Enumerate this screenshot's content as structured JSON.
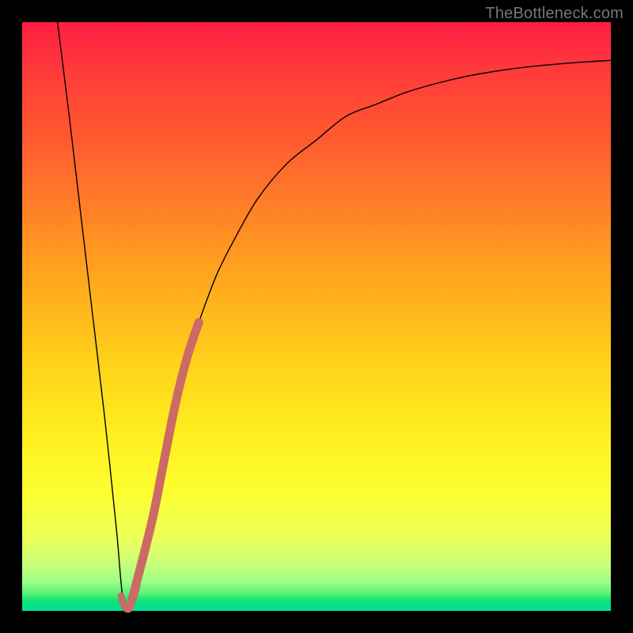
{
  "watermark": "TheBottleneck.com",
  "chart_data": {
    "type": "line",
    "title": "",
    "xlabel": "",
    "ylabel": "",
    "xlim": [
      0,
      100
    ],
    "ylim": [
      0,
      100
    ],
    "grid": false,
    "legend": false,
    "series": [
      {
        "name": "bottleneck-curve",
        "color": "#000000",
        "width": 1.4,
        "x": [
          6,
          8,
          10,
          12,
          14,
          16,
          17,
          18,
          20,
          22,
          24,
          26,
          28,
          30,
          33,
          36,
          40,
          45,
          50,
          55,
          60,
          65,
          70,
          75,
          80,
          85,
          90,
          95,
          100
        ],
        "y": [
          100,
          84,
          67,
          50,
          33,
          14,
          3,
          0,
          6,
          15,
          25,
          35,
          43,
          49,
          57,
          63,
          70,
          76,
          80,
          84,
          86,
          88,
          89.5,
          90.7,
          91.6,
          92.3,
          92.8,
          93.2,
          93.5
        ]
      },
      {
        "name": "highlight-segment",
        "color": "#cc6a66",
        "width": 11,
        "linecap": "round",
        "x": [
          18.7,
          22.0,
          24.0,
          26.0,
          28.0,
          30.0
        ],
        "y": [
          2.0,
          15.0,
          25.0,
          35.0,
          43.0,
          49.0
        ]
      },
      {
        "name": "highlight-hook",
        "color": "#cc6a66",
        "width": 9,
        "linecap": "round",
        "x": [
          16.8,
          17.5,
          18.2,
          18.8,
          19.5
        ],
        "y": [
          2.5,
          0.6,
          0.4,
          2.0,
          4.2
        ]
      }
    ]
  }
}
